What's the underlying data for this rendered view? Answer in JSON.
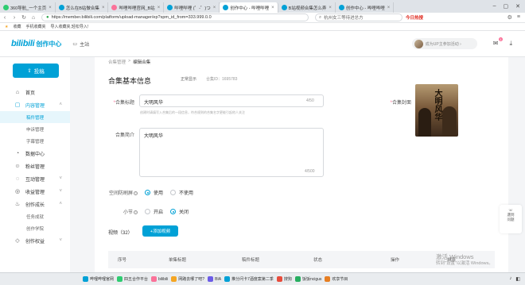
{
  "browser": {
    "tabs": [
      {
        "label": "360导航_一个主页",
        "color": "#2ecc71",
        "active": false
      },
      {
        "label": "怎么在B站做合集",
        "color": "#00a1d6",
        "active": false
      },
      {
        "label": "哔哩哔哩官网_B站",
        "color": "#fb7299",
        "active": false
      },
      {
        "label": "哔哩哔哩 (゜-゜)つ",
        "color": "#00a1d6",
        "active": false
      },
      {
        "label": "创作中心 - 哔哩哔哩",
        "color": "#00a1d6",
        "active": true
      },
      {
        "label": "B站视频合集怎么弄",
        "color": "#00a1d6",
        "active": false
      },
      {
        "label": "创作中心 - 哔哩哔哩",
        "color": "#00a1d6",
        "active": false
      }
    ],
    "url": "https://member.bilibili.com/platform/upload-manager/ep?spm_id_from=333.999.0.0",
    "search_text": "杭州女三等待进总方",
    "hot_label": "今日热搜",
    "bookmarks_label": "收藏",
    "bookmarks": [
      "手机收藏夹",
      "导入收藏夹,轻松导入!"
    ]
  },
  "header": {
    "logo": "bilibili",
    "logo_sub": "创作中心",
    "home": "主站",
    "user_hint": "成为UP主参加活动 ›",
    "badge_count": "1"
  },
  "sidebar": {
    "upload": "投稿",
    "items": [
      {
        "label": "首页",
        "icon": "home-icon",
        "glyph": "⌂"
      },
      {
        "label": "内容管理",
        "icon": "folder-icon",
        "glyph": "▢",
        "active": true,
        "expanded": true
      },
      {
        "label": "稿件管理",
        "sub": true,
        "active": true
      },
      {
        "label": "申诉管理",
        "sub": true
      },
      {
        "label": "字幕管理",
        "sub": true
      },
      {
        "label": "数据中心",
        "icon": "chart-icon",
        "glyph": "◔"
      },
      {
        "label": "粉丝管理",
        "icon": "fans-icon",
        "glyph": "☺"
      },
      {
        "label": "互动管理",
        "icon": "chat-icon",
        "glyph": "◌"
      },
      {
        "label": "收益管理",
        "icon": "coin-icon",
        "glyph": "◎"
      },
      {
        "label": "创作成长",
        "icon": "grow-icon",
        "glyph": "♨",
        "expanded": true
      },
      {
        "label": "任务成就",
        "sub": true
      },
      {
        "label": "创作学院",
        "sub": true
      },
      {
        "label": "创作权益",
        "icon": "rights-icon",
        "glyph": "◇"
      }
    ]
  },
  "main": {
    "breadcrumb": [
      "合集管理",
      ">",
      "编辑合集"
    ],
    "title": "合集基本信息",
    "status": "正常显示",
    "collection_id": "合集ID：1695783",
    "title_label": "*合集标题",
    "title_value": "大明风华",
    "title_count": "4/50",
    "title_hint": "创建时请填写入合集后的一段信息，符合规则的合集名字更能引起他人关注",
    "cover_label": "*合集封面",
    "cover_text": "大明风华",
    "intro_label": "合集简介",
    "intro_value": "大明风华",
    "intro_count": "4/500",
    "auto_label": "空间防刷屏",
    "auto_options": [
      "使用",
      "不使用"
    ],
    "section_label": "小节",
    "section_options": [
      "开启",
      "关闭"
    ],
    "videos_label": "视频（32）",
    "add_button": "+添加视频",
    "table_headers": [
      "序号",
      "单集标题",
      "稿件标题",
      "状态",
      "操作",
      "排序"
    ]
  },
  "float_help": [
    "遇到",
    "问题"
  ],
  "watermark": {
    "line1": "激活 Windows",
    "line2": "转到\"设置\"以激活 Windows。"
  },
  "taskbar": [
    {
      "label": "哔哩哔哩官网",
      "color": "#00a1d6"
    },
    {
      "label": "四五合作平台",
      "color": "#2ecc71"
    },
    {
      "label": "bilibili",
      "color": "#fb7299"
    },
    {
      "label": "网路去哪了吧?",
      "color": "#f5a623"
    },
    {
      "label": "BIA",
      "color": "#6c5ce7"
    },
    {
      "label": "推分问卡7酒度案第二季",
      "color": "#00a1d6"
    },
    {
      "label": "搜狗",
      "color": "#e74c3c"
    },
    {
      "label": "饭饭ncigus",
      "color": "#27ae60"
    },
    {
      "label": "欢享节目",
      "color": "#e67e22"
    }
  ]
}
